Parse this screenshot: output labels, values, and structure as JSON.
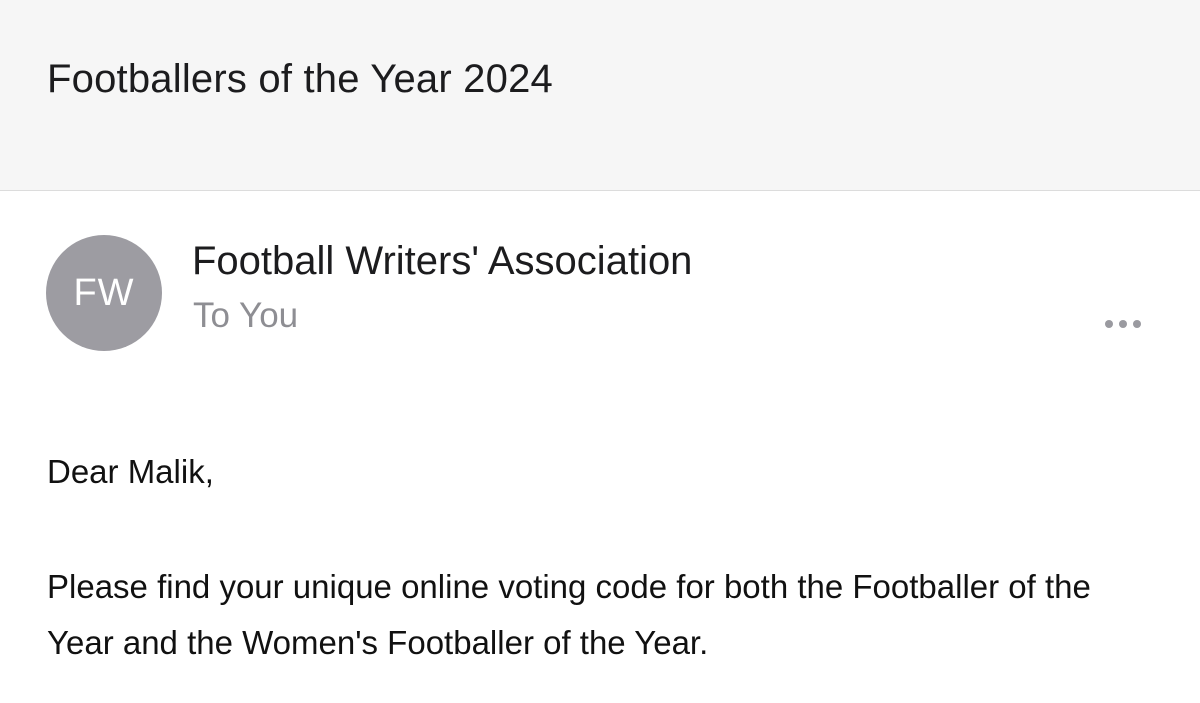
{
  "email": {
    "subject": "Footballers of the Year 2024",
    "sender": {
      "initials": "FW",
      "name": "Football Writers' Association",
      "recipient_line": "To You"
    },
    "more_icon": "more-horizontal-icon",
    "body": {
      "greeting": "Dear Malik,",
      "paragraph": "Please find your unique online voting code for both the Footballer of the Year and the Women's Footballer of the Year."
    }
  },
  "colors": {
    "header_background": "#f6f6f6",
    "avatar_background": "#9d9ca2",
    "secondary_text": "#8e8e93"
  }
}
